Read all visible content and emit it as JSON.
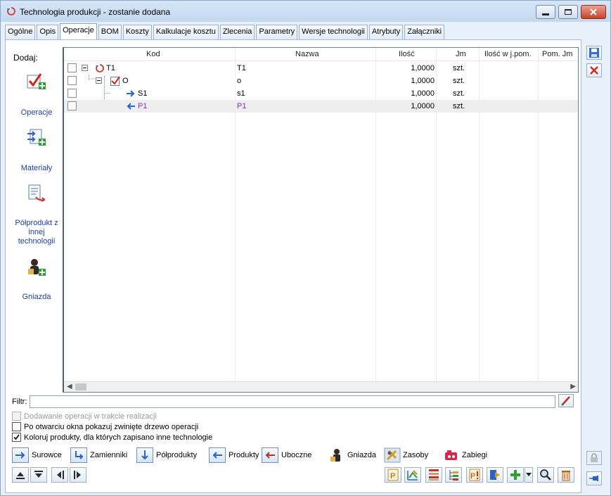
{
  "window": {
    "title": "Technologia produkcji - zostanie dodana"
  },
  "tabs": [
    {
      "label": "Ogólne"
    },
    {
      "label": "Opis"
    },
    {
      "label": "Operacje"
    },
    {
      "label": "BOM"
    },
    {
      "label": "Koszty"
    },
    {
      "label": "Kalkulacje kosztu"
    },
    {
      "label": "Zlecenia"
    },
    {
      "label": "Parametry"
    },
    {
      "label": "Wersje technologii"
    },
    {
      "label": "Atrybuty"
    },
    {
      "label": "Załączniki"
    }
  ],
  "active_tab": "Operacje",
  "sidebar": {
    "title": "Dodaj:",
    "items": [
      {
        "label": "Operacje"
      },
      {
        "label": "Materiały"
      },
      {
        "label": "Półprodukt z innej technologii",
        "lines": [
          "Półprodukt z",
          "innej",
          "technologii"
        ]
      },
      {
        "label": "Gniazda"
      }
    ]
  },
  "grid": {
    "columns": [
      "Kod",
      "Nazwa",
      "Ilość",
      "Jm",
      "Ilość w j.pom.",
      "Pom. Jm"
    ],
    "rows": [
      {
        "kod": "T1",
        "nazwa": "T1",
        "ilosc": "1,0000",
        "jm": "szt.",
        "ilosc_pom": "",
        "pom_jm": ""
      },
      {
        "kod": "O",
        "nazwa": "o",
        "ilosc": "1,0000",
        "jm": "szt.",
        "ilosc_pom": "",
        "pom_jm": ""
      },
      {
        "kod": "S1",
        "nazwa": "s1",
        "ilosc": "1,0000",
        "jm": "szt.",
        "ilosc_pom": "",
        "pom_jm": ""
      },
      {
        "kod": "P1",
        "nazwa": "P1",
        "ilosc": "1,0000",
        "jm": "szt.",
        "ilosc_pom": "",
        "pom_jm": ""
      }
    ]
  },
  "filter": {
    "label": "Filtr:",
    "value": ""
  },
  "options": [
    {
      "label": "Dodawanie operacji w trakcie realizacji",
      "checked": false,
      "disabled": true
    },
    {
      "label": "Po otwarciu okna pokazuj zwinięte drzewo operacji",
      "checked": false,
      "disabled": false
    },
    {
      "label": "Koloruj produkty, dla których zapisano inne technologie",
      "checked": true,
      "disabled": false
    }
  ],
  "legend": [
    {
      "label": "Surowce",
      "icon": "arrow-right-icon"
    },
    {
      "label": "Zamienniki",
      "icon": "arrow-turn-icon"
    },
    {
      "label": "Półprodukty",
      "icon": "arrow-down-icon"
    },
    {
      "label": "Produkty",
      "icon": "arrow-left-icon"
    },
    {
      "label": "Uboczne",
      "icon": "arrow-left-red-icon"
    },
    {
      "label": "Gniazda",
      "icon": "worker-icon"
    },
    {
      "label": "Zasoby",
      "icon": "tools-icon"
    },
    {
      "label": "Zabiegi",
      "icon": "procedure-icon"
    }
  ],
  "colors": {
    "accent_blue": "#1e3fa8",
    "product_purple": "#8a2be2",
    "selected_row": "#eeeeee"
  }
}
